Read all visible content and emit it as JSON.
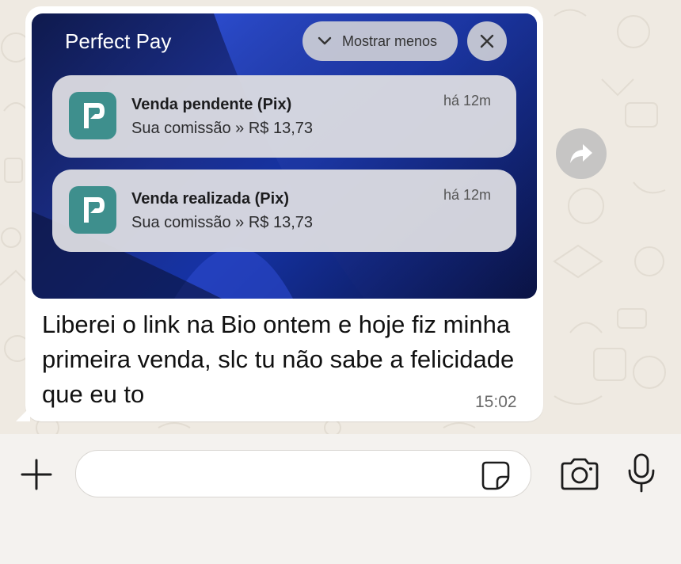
{
  "screenshot": {
    "app_name": "Perfect Pay",
    "show_less_label": "Mostrar menos",
    "notifications": [
      {
        "title": "Venda pendente (Pix)",
        "body": "Sua comissão » R$ 13,73",
        "time": "há 12m"
      },
      {
        "title": "Venda realizada (Pix)",
        "body": "Sua comissão » R$ 13,73",
        "time": "há 12m"
      }
    ]
  },
  "message": {
    "text": "Liberei o link na Bio ontem e hoje fiz minha primeira venda, slc tu não sabe a felicidade que eu to",
    "time": "15:02"
  },
  "composer": {
    "placeholder": "",
    "value": ""
  },
  "icons": {
    "add": "plus-icon",
    "sticker": "sticker-icon",
    "camera": "camera-icon",
    "mic": "microphone-icon",
    "forward": "forward-icon",
    "close": "close-icon",
    "chevron": "chevron-down-icon",
    "app_logo": "perfect-pay-logo"
  },
  "colors": {
    "chat_background": "#efeae2",
    "bubble": "#ffffff",
    "app_icon": "#3e8f8d",
    "screenshot_bg": "#1533a6"
  }
}
